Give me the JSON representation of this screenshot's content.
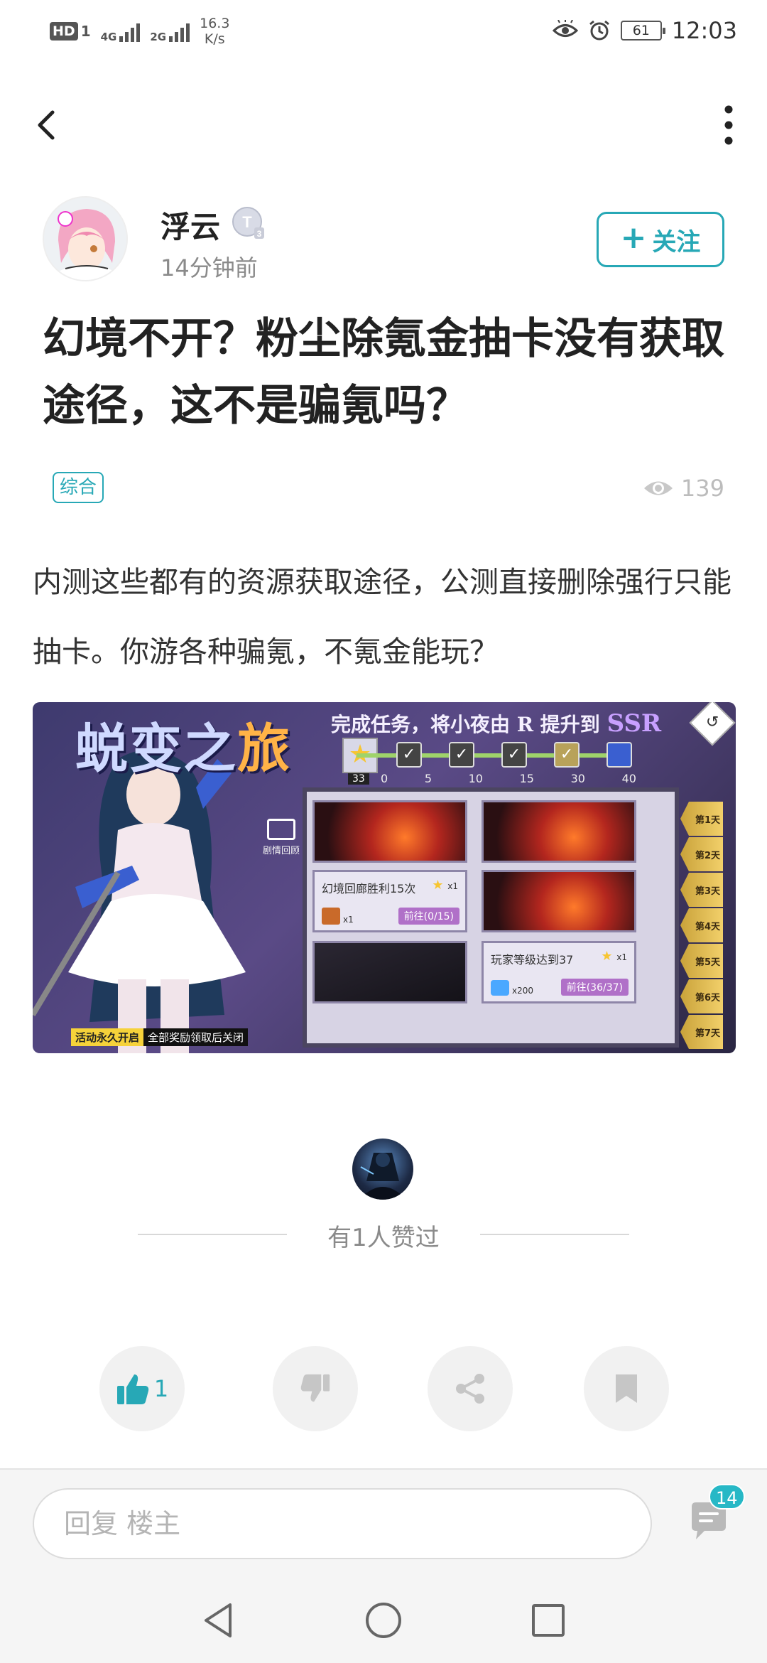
{
  "status_bar": {
    "hd": "HD",
    "sim1": "1",
    "net1": "4G",
    "net2": "2G",
    "speed_value": "16.3",
    "speed_unit": "K/s",
    "battery": "61",
    "time": "12:03"
  },
  "author": {
    "name": "浮云",
    "level_badge": "T",
    "level_num": "3",
    "time_ago": "14分钟前",
    "follow_label": "关注"
  },
  "post": {
    "title": "幻境不开？粉尘除氪金抽卡没有获取途径，这不是骗氪吗？",
    "tag": "综合",
    "views": "139",
    "body": "内测这些都有的资源获取途径，公测直接删除强行只能抽卡。你游各种骗氪，不氪金能玩？"
  },
  "image": {
    "title_a": "蜕变之",
    "title_b": "旅",
    "mission": "完成任务，将小夜由",
    "mission_r": "R",
    "mission_mid": "提升到",
    "mission_ssr": "SSR",
    "badge_33": "33",
    "ticks": [
      "0",
      "5",
      "10",
      "15",
      "30",
      "40"
    ],
    "replay": "剧情回顾",
    "task1": "幻境回廊胜利15次",
    "task1_qty": "x1",
    "task1_reward": "x1",
    "task1_go": "前往(0/15)",
    "task2": "玩家等级达到37",
    "task2_qty": "x1",
    "task2_reward": "x200",
    "task2_go": "前往(36/37)",
    "days": [
      "第1天",
      "第2天",
      "第3天",
      "第4天",
      "第5天",
      "第6天",
      "第7天"
    ],
    "event_a": "活动永久开启",
    "event_b": "全部奖励领取后关闭"
  },
  "likes": {
    "text": "有1人赞过"
  },
  "actions": {
    "like_count": "1"
  },
  "reply": {
    "placeholder": "回复  楼主",
    "comment_count": "14"
  },
  "colors": {
    "accent": "#27a8b6",
    "badge": "#27b8c6"
  }
}
